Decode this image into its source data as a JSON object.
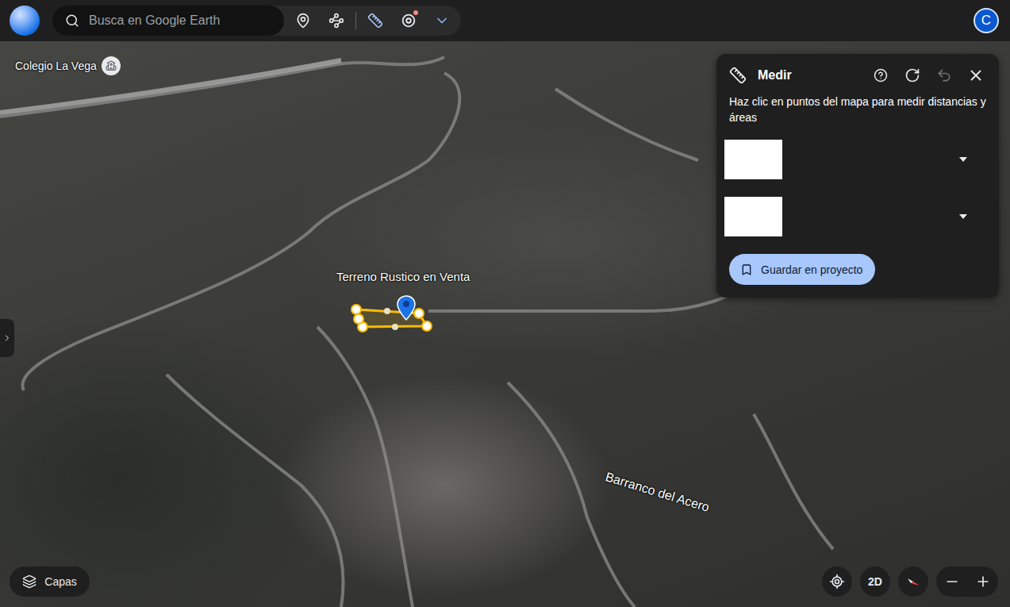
{
  "search": {
    "placeholder": "Busca en Google Earth"
  },
  "tools": [
    {
      "kind": "pin",
      "selected": false,
      "badge": false
    },
    {
      "kind": "path",
      "selected": false,
      "badge": false
    },
    {
      "kind": "ruler",
      "selected": true,
      "badge": false
    },
    {
      "kind": "voyager",
      "selected": false,
      "badge": true
    }
  ],
  "account": {
    "initial": "C"
  },
  "map": {
    "school_label": "Colegio La Vega",
    "placemark_label": "Terreno Rustico en Venta",
    "area_label": "Barranco del Acero"
  },
  "measure_panel": {
    "title": "Medir",
    "hint": "Haz clic en puntos del mapa para medir distancias y áreas",
    "undo_disabled": true,
    "rows": [
      {
        "value": ""
      },
      {
        "value": ""
      }
    ],
    "save_button": "Guardar en proyecto"
  },
  "layers_button": "Capas",
  "view_mode_button": "2D"
}
